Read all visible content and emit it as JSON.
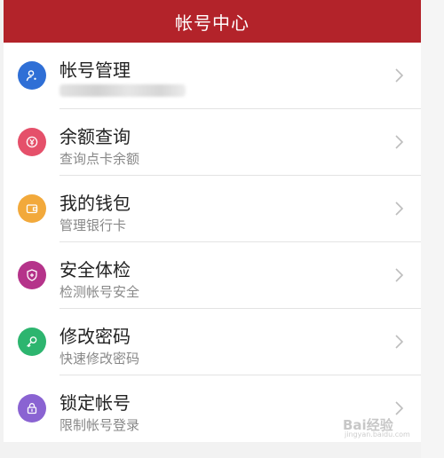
{
  "header": {
    "title": "帐号中心"
  },
  "items": [
    {
      "title": "帐号管理",
      "subtitle": "",
      "icon": "user-icon",
      "color": "#2f6fd6"
    },
    {
      "title": "余额查询",
      "subtitle": "查询点卡余额",
      "icon": "yen-coin-icon",
      "color": "#e5506a"
    },
    {
      "title": "我的钱包",
      "subtitle": "管理银行卡",
      "icon": "wallet-icon",
      "color": "#f2a93b"
    },
    {
      "title": "安全体检",
      "subtitle": "检测帐号安全",
      "icon": "shield-icon",
      "color": "#b5338a"
    },
    {
      "title": "修改密码",
      "subtitle": "快速修改密码",
      "icon": "key-icon",
      "color": "#2db56f"
    },
    {
      "title": "锁定帐号",
      "subtitle": "限制帐号登录",
      "icon": "lock-icon",
      "color": "#8a63d2"
    }
  ],
  "colors": {
    "header_bg": "#b3232a",
    "title_text": "#222222",
    "subtitle_text": "#888888"
  },
  "watermark": {
    "text": "Bai经验",
    "subtext": "jingyan.baidu.com"
  }
}
